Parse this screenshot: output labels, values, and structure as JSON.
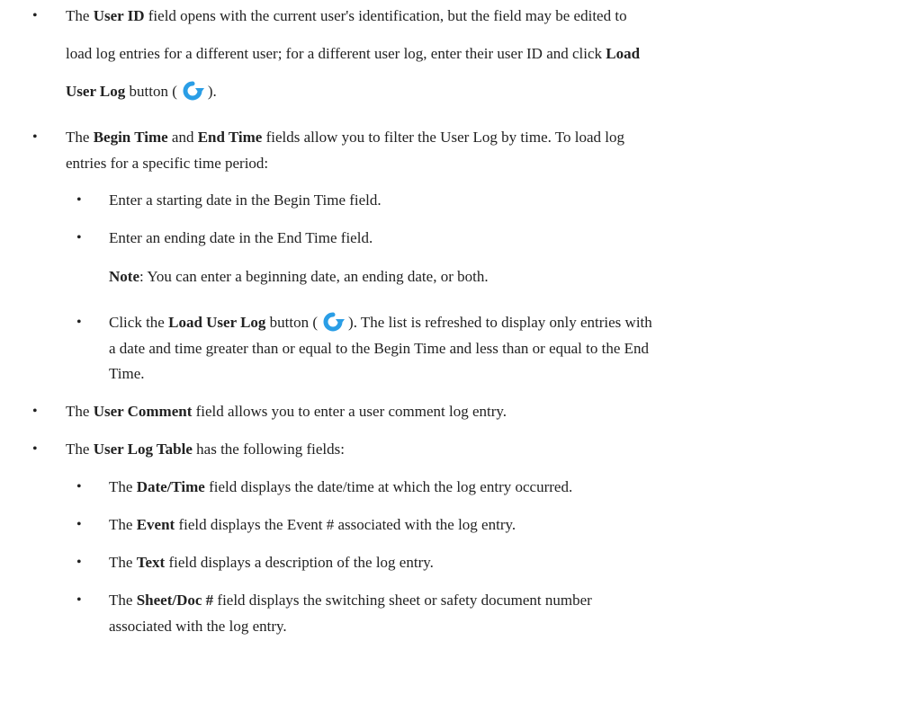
{
  "bullet_char": "•",
  "icon_name": "reload-icon",
  "icon_color": "#2a9ee6",
  "items": {
    "user_id": {
      "p1": "The ",
      "b1": "User ID",
      "p2": " field opens with the current user's identification, but the field may be edited to",
      "line2": "load log entries for a different user; for a different user log, enter their user ID and click ",
      "b2": "Load",
      "b3": "User Log",
      "p3": " button (",
      "p4": ")."
    },
    "time": {
      "p1": "The ",
      "b1": "Begin Time",
      "p2": " and ",
      "b2": "End Time",
      "p3": " fields allow you to filter the User Log by time. To load log",
      "line2": "entries for a specific time period:"
    },
    "begin": "Enter a starting date in the Begin Time field.",
    "end": "Enter an ending date in the End Time field.",
    "note": {
      "label": "Note",
      "text": ": You can enter a beginning date, an ending date, or both."
    },
    "click": {
      "p1": "Click the ",
      "b1": "Load User Log",
      "p2": " button (",
      "p3": "). The list is refreshed to display only entries with",
      "line2": "a date and time greater than or equal to the Begin Time and less than or equal to the End",
      "line3": "Time."
    },
    "comment": {
      "p1": "The ",
      "b1": "User Comment",
      "p2": " field allows you to enter a user comment log entry."
    },
    "table": {
      "p1": "The ",
      "b1": "User Log Table",
      "p2": " has the following fields:"
    },
    "datetime": {
      "p1": "The ",
      "b1": "Date/Time",
      "p2": " field displays the date/time at which the log entry occurred."
    },
    "event": {
      "p1": "The ",
      "b1": "Event",
      "p2": " field displays the Event # associated with the log entry."
    },
    "textfield": {
      "p1": "The ",
      "b1": "Text",
      "p2": " field displays a description of the log entry."
    },
    "sheet": {
      "p1": "The ",
      "b1": "Sheet/Doc #",
      "p2": " field displays the switching sheet or safety document number",
      "line2": "associated with the log entry."
    }
  }
}
